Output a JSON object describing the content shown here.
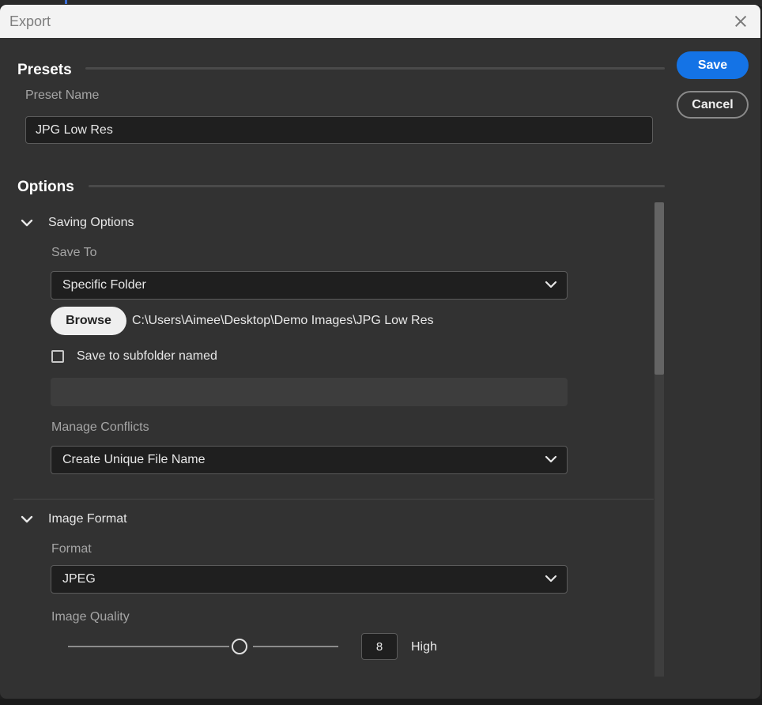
{
  "window": {
    "title": "Export"
  },
  "buttons": {
    "save": "Save",
    "cancel": "Cancel",
    "browse": "Browse"
  },
  "presets": {
    "heading": "Presets",
    "preset_name_label": "Preset Name",
    "preset_name_value": "JPG Low Res"
  },
  "options": {
    "heading": "Options",
    "saving_options": {
      "title": "Saving Options",
      "save_to_label": "Save To",
      "save_to_value": "Specific Folder",
      "folder_path": "C:\\Users\\Aimee\\Desktop\\Demo Images\\JPG Low Res",
      "subfolder_checkbox_label": "Save to subfolder named",
      "subfolder_checked": false,
      "subfolder_value": "",
      "manage_conflicts_label": "Manage Conflicts",
      "manage_conflicts_value": "Create Unique File Name"
    },
    "image_format": {
      "title": "Image Format",
      "format_label": "Format",
      "format_value": "JPEG",
      "image_quality_label": "Image Quality",
      "quality_value": "8",
      "quality_text": "High",
      "quality_max": 12
    }
  },
  "icons": {
    "close": "close-icon",
    "dropdown": "chevron-down-icon",
    "disclosure": "chevron-down-icon"
  },
  "colors": {
    "accent": "#1473e6",
    "dialog_bg": "#323232",
    "titlebar_bg": "#f3f3f3"
  }
}
